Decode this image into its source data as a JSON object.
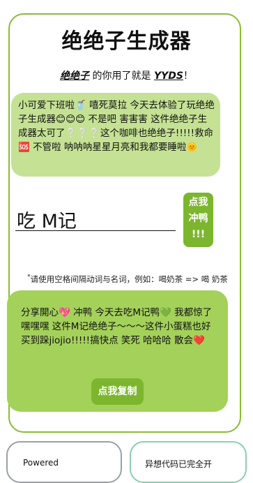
{
  "header": {
    "title": "绝绝子生成器",
    "subtitle_prefix": "",
    "subtitle_word1": "绝绝子",
    "subtitle_mid": " 的你用了就是 ",
    "subtitle_word2": "YYDS",
    "subtitle_suffix": "！"
  },
  "intro": {
    "text": "小可爱下班啦🥤 嘻死莫拉 今天去体验了玩绝绝子生成器😊😊😊 不是吧 害害害 这件绝绝子生成器太可了❔❔❔这个咖啡也绝绝子!!!!!救命🆘 不管啦 呐呐呐星星月亮和我都要睡啦🌞"
  },
  "input": {
    "value": "吃 M记"
  },
  "go_button": {
    "label_line1": "点我",
    "label_line2": "冲鸭",
    "label_line3": "!!!"
  },
  "hint": {
    "star": "*",
    "text": "请使用空格间隔动词与名词，例如：喝奶茶 => 喝 奶茶"
  },
  "result": {
    "text": "分享開心💖 冲鸭 今天去吃M记鸭💚 我都惊了 嘿嘿嘿 这件M记绝绝子～～～这件小蛋糕也好买到跺jiojio!!!!!搞快点 笑死 哈哈哈 散会❤️",
    "copy_label": "点我复制"
  },
  "footer": {
    "left_text": "Powered",
    "right_text": "异想代码已完全开"
  },
  "colors": {
    "card_border": "#8bbb3a",
    "intro_bg": "#c5e294",
    "result_bg": "#a4d15a",
    "button_bg": "#7cb62e",
    "footer_left_border": "#9aa0a6",
    "footer_right_border": "#88d0b0"
  }
}
